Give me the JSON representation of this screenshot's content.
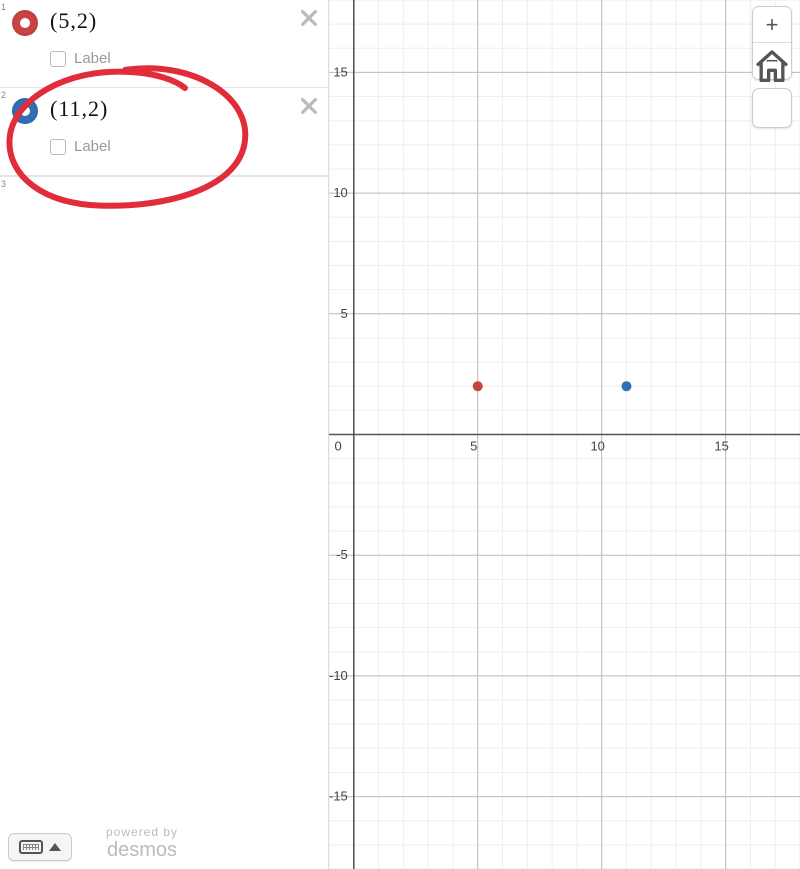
{
  "expressions": [
    {
      "index": "1",
      "color": "red",
      "formula": "(5,2)",
      "label_text": "Label",
      "label_checked": false
    },
    {
      "index": "2",
      "color": "blue",
      "formula": "(11,2)",
      "label_text": "Label",
      "label_checked": false
    }
  ],
  "next_index": "3",
  "footer": {
    "powered_by": "powered by",
    "brand": "desmos"
  },
  "zoom": {
    "in": "+",
    "out": "−"
  },
  "axes": {
    "x_ticks": [
      "0",
      "5",
      "10",
      "15"
    ],
    "y_ticks_pos": [
      "5",
      "10",
      "15"
    ],
    "y_ticks_neg": [
      "-5",
      "-10",
      "-15"
    ]
  },
  "chart_data": {
    "type": "scatter",
    "title": "",
    "xlabel": "",
    "ylabel": "",
    "xlim": [
      -1,
      18
    ],
    "ylim": [
      -18,
      18
    ],
    "x_tick_step": 5,
    "y_tick_step": 5,
    "minor_grid_step": 1,
    "series": [
      {
        "name": "(5,2)",
        "color": "#c74440",
        "x": [
          5
        ],
        "y": [
          2
        ]
      },
      {
        "name": "(11,2)",
        "color": "#2d70b3",
        "x": [
          11
        ],
        "y": [
          2
        ]
      }
    ]
  }
}
